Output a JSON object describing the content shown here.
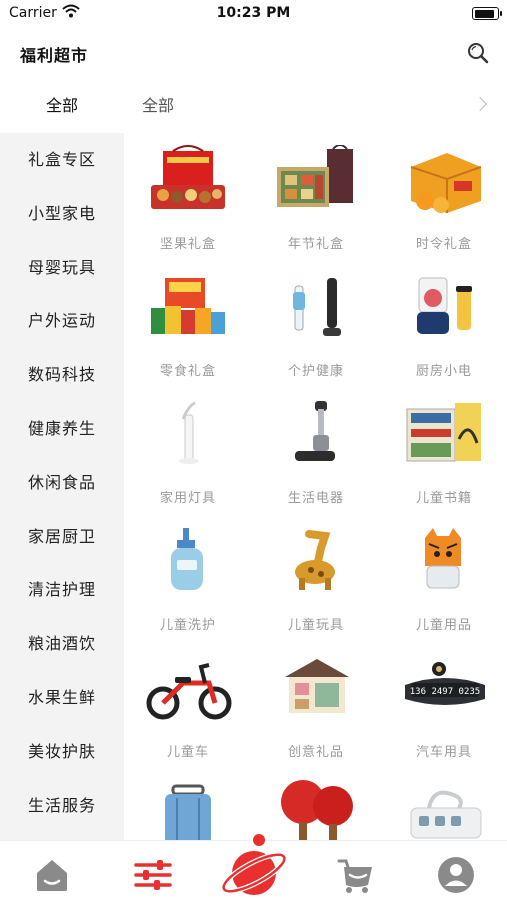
{
  "status_bar": {
    "carrier": "Carrier",
    "time": "10:23 PM",
    "battery_level": 0.92
  },
  "header": {
    "title": "福利超市",
    "search_icon": "search-icon"
  },
  "sidebar": {
    "all_label": "全部",
    "items": [
      "礼盒专区",
      "小型家电",
      "母婴玩具",
      "户外运动",
      "数码科技",
      "健康养生",
      "休闲食品",
      "家居厨卫",
      "清洁护理",
      "粮油酒饮",
      "水果生鲜",
      "美妆护肤",
      "生活服务"
    ]
  },
  "content": {
    "header_label": "全部",
    "grid": [
      {
        "label": "坚果礼盒",
        "icon": "nut-gift-box-icon"
      },
      {
        "label": "年节礼盒",
        "icon": "festival-gift-box-icon"
      },
      {
        "label": "时令礼盒",
        "icon": "seasonal-fruit-box-icon"
      },
      {
        "label": "零食礼盒",
        "icon": "snack-gift-box-icon"
      },
      {
        "label": "个护健康",
        "icon": "personal-care-icon"
      },
      {
        "label": "厨房小电",
        "icon": "blender-icon"
      },
      {
        "label": "家用灯具",
        "icon": "lamp-icon"
      },
      {
        "label": "生活电器",
        "icon": "floor-washer-icon"
      },
      {
        "label": "儿童书籍",
        "icon": "book-set-icon"
      },
      {
        "label": "儿童洗护",
        "icon": "baby-lotion-icon"
      },
      {
        "label": "儿童玩具",
        "icon": "giraffe-toy-icon"
      },
      {
        "label": "儿童用品",
        "icon": "tiger-bottle-icon"
      },
      {
        "label": "儿童车",
        "icon": "balance-bike-icon"
      },
      {
        "label": "创意礼品",
        "icon": "miniature-house-icon"
      },
      {
        "label": "汽车用具",
        "icon": "car-phone-plate-icon",
        "plate_text": "136 2497 0235"
      },
      {
        "label": "",
        "icon": "suitcase-icon"
      },
      {
        "label": "",
        "icon": "ping-pong-paddle-icon"
      },
      {
        "label": "",
        "icon": "power-strip-icon"
      }
    ]
  },
  "tabbar": {
    "active_index": 1,
    "accent": "#e8302e",
    "tabs": [
      {
        "icon": "home-icon"
      },
      {
        "icon": "category-sliders-icon"
      },
      {
        "icon": "planet-icon"
      },
      {
        "icon": "cart-icon"
      },
      {
        "icon": "profile-icon"
      }
    ]
  }
}
